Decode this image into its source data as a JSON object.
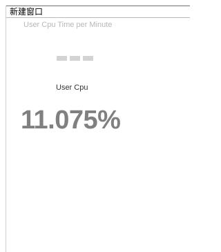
{
  "window": {
    "title": "新建窗口"
  },
  "widget": {
    "subtitle": "User Cpu Time per Minute",
    "metric_label": "User Cpu",
    "metric_value": "11.075%"
  },
  "colors": {
    "subtitle": "#b8b8b8",
    "value": "#808080",
    "placeholder_bars": "#d3d3d3"
  }
}
